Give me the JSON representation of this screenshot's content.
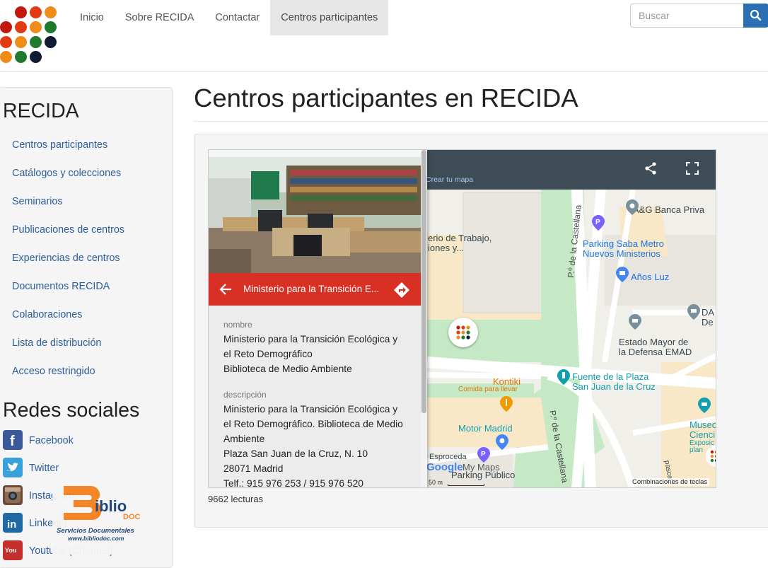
{
  "nav": {
    "items": [
      {
        "label": "Inicio",
        "active": false
      },
      {
        "label": "Sobre RECIDA",
        "active": false
      },
      {
        "label": "Contactar",
        "active": false
      },
      {
        "label": "Centros participantes",
        "active": true
      }
    ],
    "search_placeholder": "Buscar"
  },
  "sidebar": {
    "heading": "RECIDA",
    "links": [
      "Centros participantes",
      "Catálogos y colecciones",
      "Seminarios",
      "Publicaciones de centros",
      "Experiencias de centros",
      "Documentos RECIDA",
      "Colaboraciones",
      "Lista de distribución",
      "Acceso restringido"
    ],
    "social_heading": "Redes sociales",
    "social": [
      {
        "label": "Facebook",
        "icon": "facebook-icon",
        "color": "#3b5998"
      },
      {
        "label": "Twitter",
        "icon": "twitter-icon",
        "color": "#38a1d9"
      },
      {
        "label": "Instagram",
        "icon": "instagram-icon",
        "color": "#6b4a3a"
      },
      {
        "label": "Linkedin",
        "icon": "linkedin-icon",
        "color": "#1f6aa5"
      },
      {
        "label": "Youtube (Channel)",
        "icon": "youtube-icon",
        "color": "#c4302b"
      }
    ],
    "sponsor": {
      "name": "iblio",
      "sub": "DOC",
      "tagline": "Servicios Documentales",
      "url": "www.bibliodoc.com"
    }
  },
  "main": {
    "title": "Centros participantes en RECIDA",
    "reads": "9662 lecturas"
  },
  "map": {
    "create_link": "Crear tu mapa",
    "place_title": "Ministerio para la Transición E...",
    "fields": [
      {
        "label": "nombre",
        "lines": [
          "Ministerio para la Transición Ecológica y",
          "el Reto Demográfico",
          "Biblioteca de Medio Ambiente"
        ]
      },
      {
        "label": "descripción",
        "lines": [
          "Ministerio para la Transición Ecológica y",
          "el Reto Demográfico. Biblioteca de Medio",
          "Ambiente",
          "Plaza San Juan de la Cruz, N. 10",
          "28071 Madrid",
          "Telf.: 915 976 253 / 915 976 520"
        ]
      }
    ],
    "labels": {
      "ab_banca": "A&G Banca Priva",
      "trabajo": "erio de Trabajo,",
      "trabajo2": "iones y...",
      "parking_saba": "Parking Saba Metro",
      "nuevos_ministerios": "Nuevos Ministerios",
      "anos_luz": "Años Luz",
      "castellana1": "P.º de la Castellana",
      "castellana2": "P.º de la Castellana",
      "da": "DA",
      "de": "De",
      "estado_mayor": "Estado Mayor de",
      "defensa": "la Defensa EMAD",
      "kontiki": "Kontiki",
      "comida": "Comida para llevar",
      "fuente": "Fuente de la Plaza",
      "san_juan": "San Juan de la Cruz",
      "motor": "Motor Madrid",
      "museo": "Museo",
      "ciencia": "Cienci",
      "expo": "Exposic",
      "plan": "plan",
      "esproceda": "Esproceda",
      "parking_publico": "Parking Público",
      "google": "Google",
      "mymaps": "My Maps",
      "scale": "50 m",
      "shortcuts": "Combinaciones de teclas",
      "pascal": "pascal"
    }
  }
}
